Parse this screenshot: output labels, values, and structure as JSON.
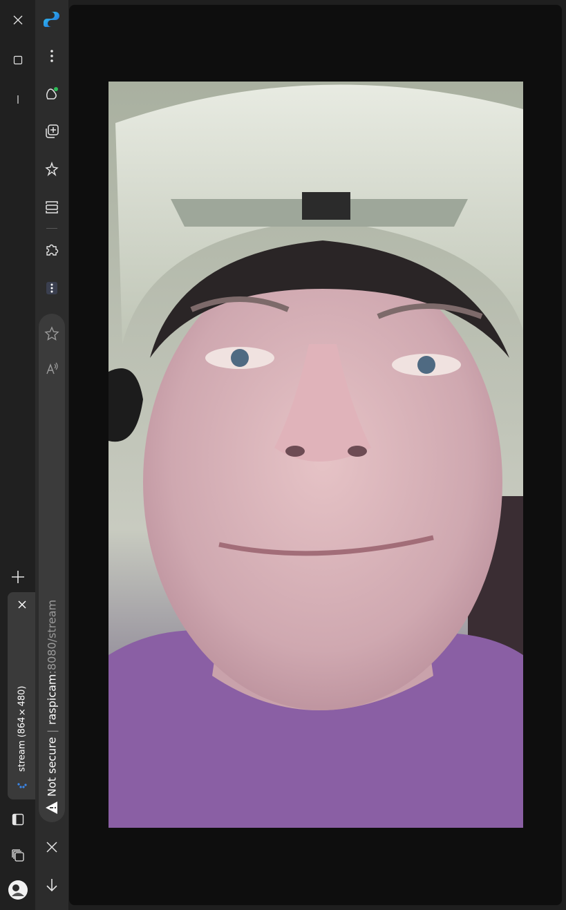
{
  "tab": {
    "title": "stream (864×480)",
    "close_label": "Close tab"
  },
  "address": {
    "security": "Not secure",
    "divider": "|",
    "host": "raspicam",
    "path": ":8080/stream"
  },
  "icons": {
    "window_close": "close-icon",
    "window_restore": "restore-icon",
    "window_minimize": "minimize-icon",
    "new_tab": "plus-icon",
    "browser_logo": "edge-logo-icon",
    "more": "more-vertical-icon",
    "copilot": "copilot-icon",
    "collections_add": "add-collection-icon",
    "feedback": "feedback-icon",
    "split_screen": "split-screen-icon",
    "extensions": "puzzle-icon",
    "extension_dots": "extension-dots-icon",
    "favorite": "star-icon",
    "read_aloud": "read-aloud-icon",
    "security_warning": "warning-icon",
    "stop": "close-icon",
    "downloads": "download-icon",
    "sidebar_toggle": "sidebar-icon",
    "tab_collections": "tab-actions-icon",
    "profile": "avatar-icon"
  },
  "colors": {
    "tabstrip_bg": "#202020",
    "toolbar_bg": "#2c2c2c",
    "content_bg": "#0e0e0e",
    "accent": "#3a86e8"
  }
}
